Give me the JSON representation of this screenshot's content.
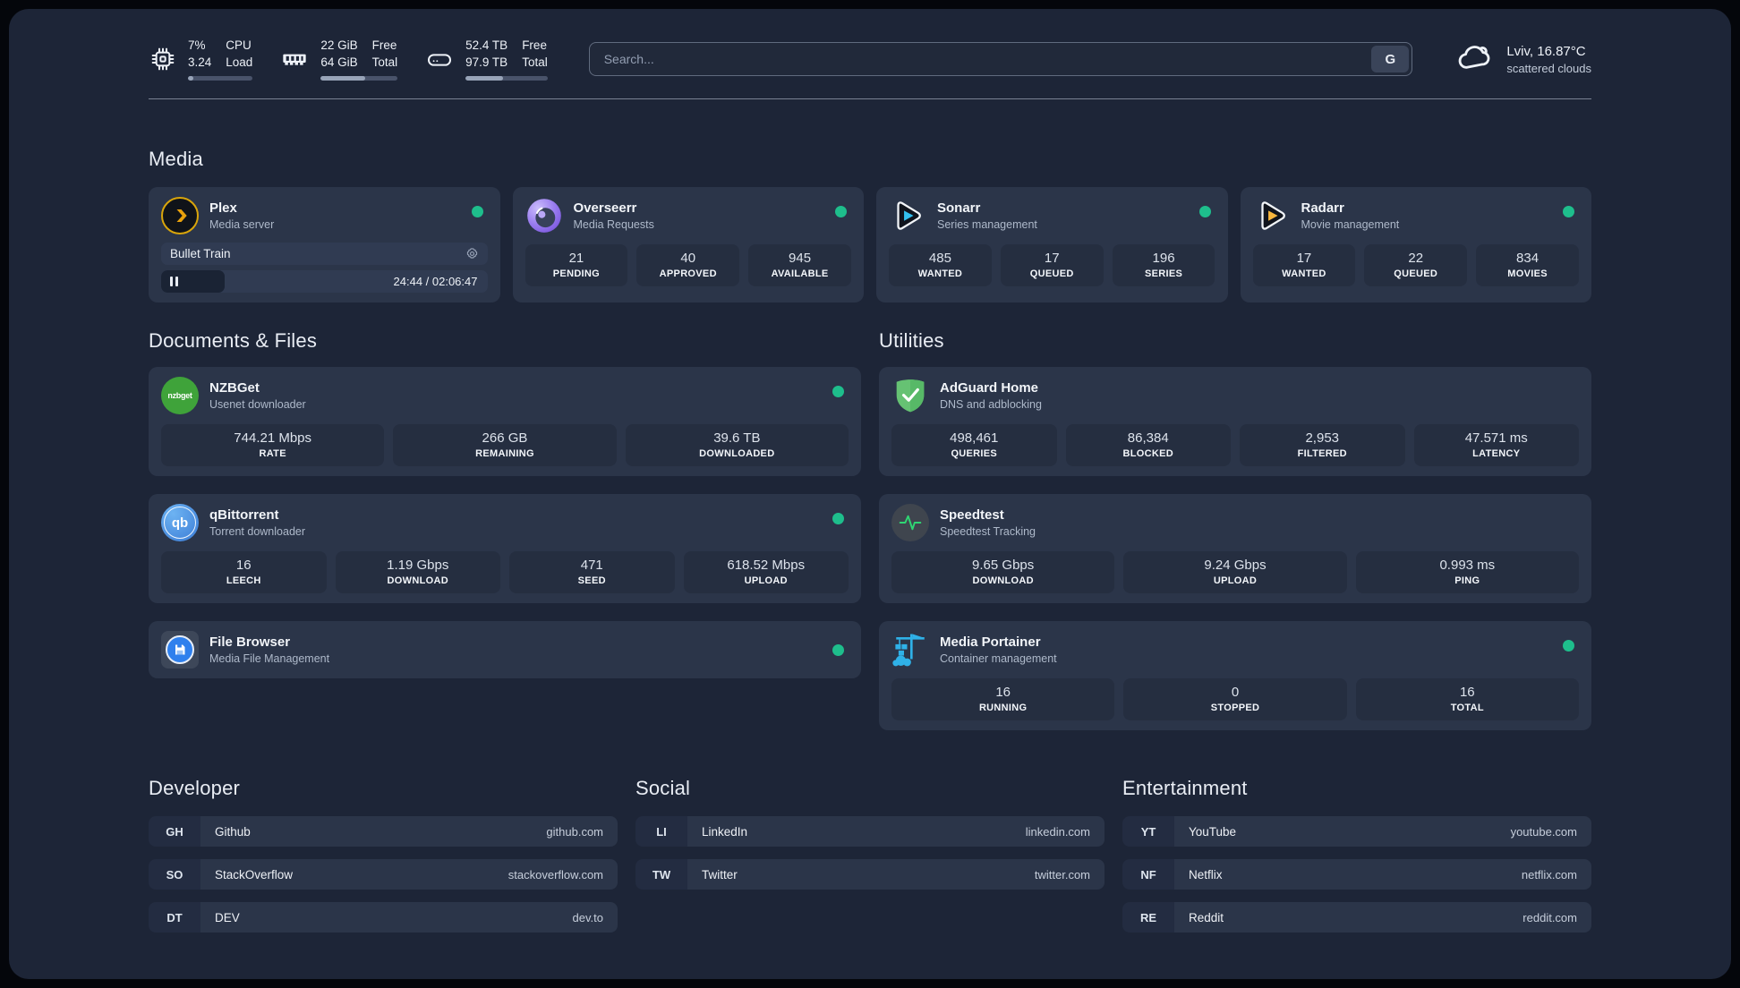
{
  "topbar": {
    "cpu": {
      "icon": "cpu-icon",
      "value": "7%",
      "sub": "3.24",
      "label": "CPU",
      "sublabel": "Load",
      "progress": 8
    },
    "ram": {
      "icon": "ram-icon",
      "value": "22 GiB",
      "sub": "64 GiB",
      "label": "Free",
      "sublabel": "Total",
      "progress": 58
    },
    "disk": {
      "icon": "disk-icon",
      "value": "52.4 TB",
      "sub": "97.9 TB",
      "label": "Free",
      "sublabel": "Total",
      "progress": 46
    },
    "search": {
      "placeholder": "Search...",
      "engine_button": "G"
    },
    "weather": {
      "icon": "cloud-icon",
      "location": "Lviv, 16.87°C",
      "condition": "scattered clouds"
    }
  },
  "sections": {
    "media": {
      "title": "Media"
    },
    "documents": {
      "title": "Documents & Files"
    },
    "utilities": {
      "title": "Utilities"
    },
    "developer": {
      "title": "Developer"
    },
    "social": {
      "title": "Social"
    },
    "entertainment": {
      "title": "Entertainment"
    }
  },
  "apps": {
    "plex": {
      "icon": "plex-icon",
      "name": "Plex",
      "description": "Media server",
      "online": true,
      "player": {
        "title": "Bullet Train",
        "time": "24:44 / 02:06:47",
        "progress_pct": 19.5
      }
    },
    "overseerr": {
      "icon": "overseerr-icon",
      "name": "Overseerr",
      "description": "Media Requests",
      "online": true,
      "stats": [
        {
          "value": "21",
          "label": "PENDING"
        },
        {
          "value": "40",
          "label": "APPROVED"
        },
        {
          "value": "945",
          "label": "AVAILABLE"
        }
      ]
    },
    "sonarr": {
      "icon": "sonarr-icon",
      "name": "Sonarr",
      "description": "Series management",
      "online": true,
      "stats": [
        {
          "value": "485",
          "label": "WANTED"
        },
        {
          "value": "17",
          "label": "QUEUED"
        },
        {
          "value": "196",
          "label": "SERIES"
        }
      ]
    },
    "radarr": {
      "icon": "radarr-icon",
      "name": "Radarr",
      "description": "Movie management",
      "online": true,
      "stats": [
        {
          "value": "17",
          "label": "WANTED"
        },
        {
          "value": "22",
          "label": "QUEUED"
        },
        {
          "value": "834",
          "label": "MOVIES"
        }
      ]
    },
    "nzbget": {
      "icon": "nzbget-icon",
      "name": "NZBGet",
      "description": "Usenet downloader",
      "online": true,
      "stats": [
        {
          "value": "744.21 Mbps",
          "label": "RATE"
        },
        {
          "value": "266 GB",
          "label": "REMAINING"
        },
        {
          "value": "39.6 TB",
          "label": "DOWNLOADED"
        }
      ]
    },
    "qbittorrent": {
      "icon": "qbittorrent-icon",
      "name": "qBittorrent",
      "description": "Torrent downloader",
      "online": true,
      "stats": [
        {
          "value": "16",
          "label": "LEECH"
        },
        {
          "value": "1.19 Gbps",
          "label": "DOWNLOAD"
        },
        {
          "value": "471",
          "label": "SEED"
        },
        {
          "value": "618.52 Mbps",
          "label": "UPLOAD"
        }
      ]
    },
    "filebrowser": {
      "icon": "filebrowser-icon",
      "name": "File Browser",
      "description": "Media File Management",
      "online": true
    },
    "adguard": {
      "icon": "adguard-icon",
      "name": "AdGuard Home",
      "description": "DNS and adblocking",
      "stats": [
        {
          "value": "498,461",
          "label": "QUERIES"
        },
        {
          "value": "86,384",
          "label": "BLOCKED"
        },
        {
          "value": "2,953",
          "label": "FILTERED"
        },
        {
          "value": "47.571 ms",
          "label": "LATENCY"
        }
      ]
    },
    "speedtest": {
      "icon": "speedtest-icon",
      "name": "Speedtest",
      "description": "Speedtest Tracking",
      "stats": [
        {
          "value": "9.65 Gbps",
          "label": "DOWNLOAD"
        },
        {
          "value": "9.24 Gbps",
          "label": "UPLOAD"
        },
        {
          "value": "0.993 ms",
          "label": "PING"
        }
      ]
    },
    "portainer": {
      "icon": "portainer-icon",
      "name": "Media Portainer",
      "description": "Container management",
      "online": true,
      "stats": [
        {
          "value": "16",
          "label": "RUNNING"
        },
        {
          "value": "0",
          "label": "STOPPED"
        },
        {
          "value": "16",
          "label": "TOTAL"
        }
      ]
    }
  },
  "links": {
    "developer": [
      {
        "tag": "GH",
        "name": "Github",
        "url": "github.com"
      },
      {
        "tag": "SO",
        "name": "StackOverflow",
        "url": "stackoverflow.com"
      },
      {
        "tag": "DT",
        "name": "DEV",
        "url": "dev.to"
      }
    ],
    "social": [
      {
        "tag": "LI",
        "name": "LinkedIn",
        "url": "linkedin.com"
      },
      {
        "tag": "TW",
        "name": "Twitter",
        "url": "twitter.com"
      }
    ],
    "entertainment": [
      {
        "tag": "YT",
        "name": "YouTube",
        "url": "youtube.com"
      },
      {
        "tag": "NF",
        "name": "Netflix",
        "url": "netflix.com"
      },
      {
        "tag": "RE",
        "name": "Reddit",
        "url": "reddit.com"
      }
    ]
  },
  "colors": {
    "status_online": "#1ebe8c",
    "background": "#1d2537",
    "card": "#2b3549",
    "stat_box": "#252e40"
  }
}
